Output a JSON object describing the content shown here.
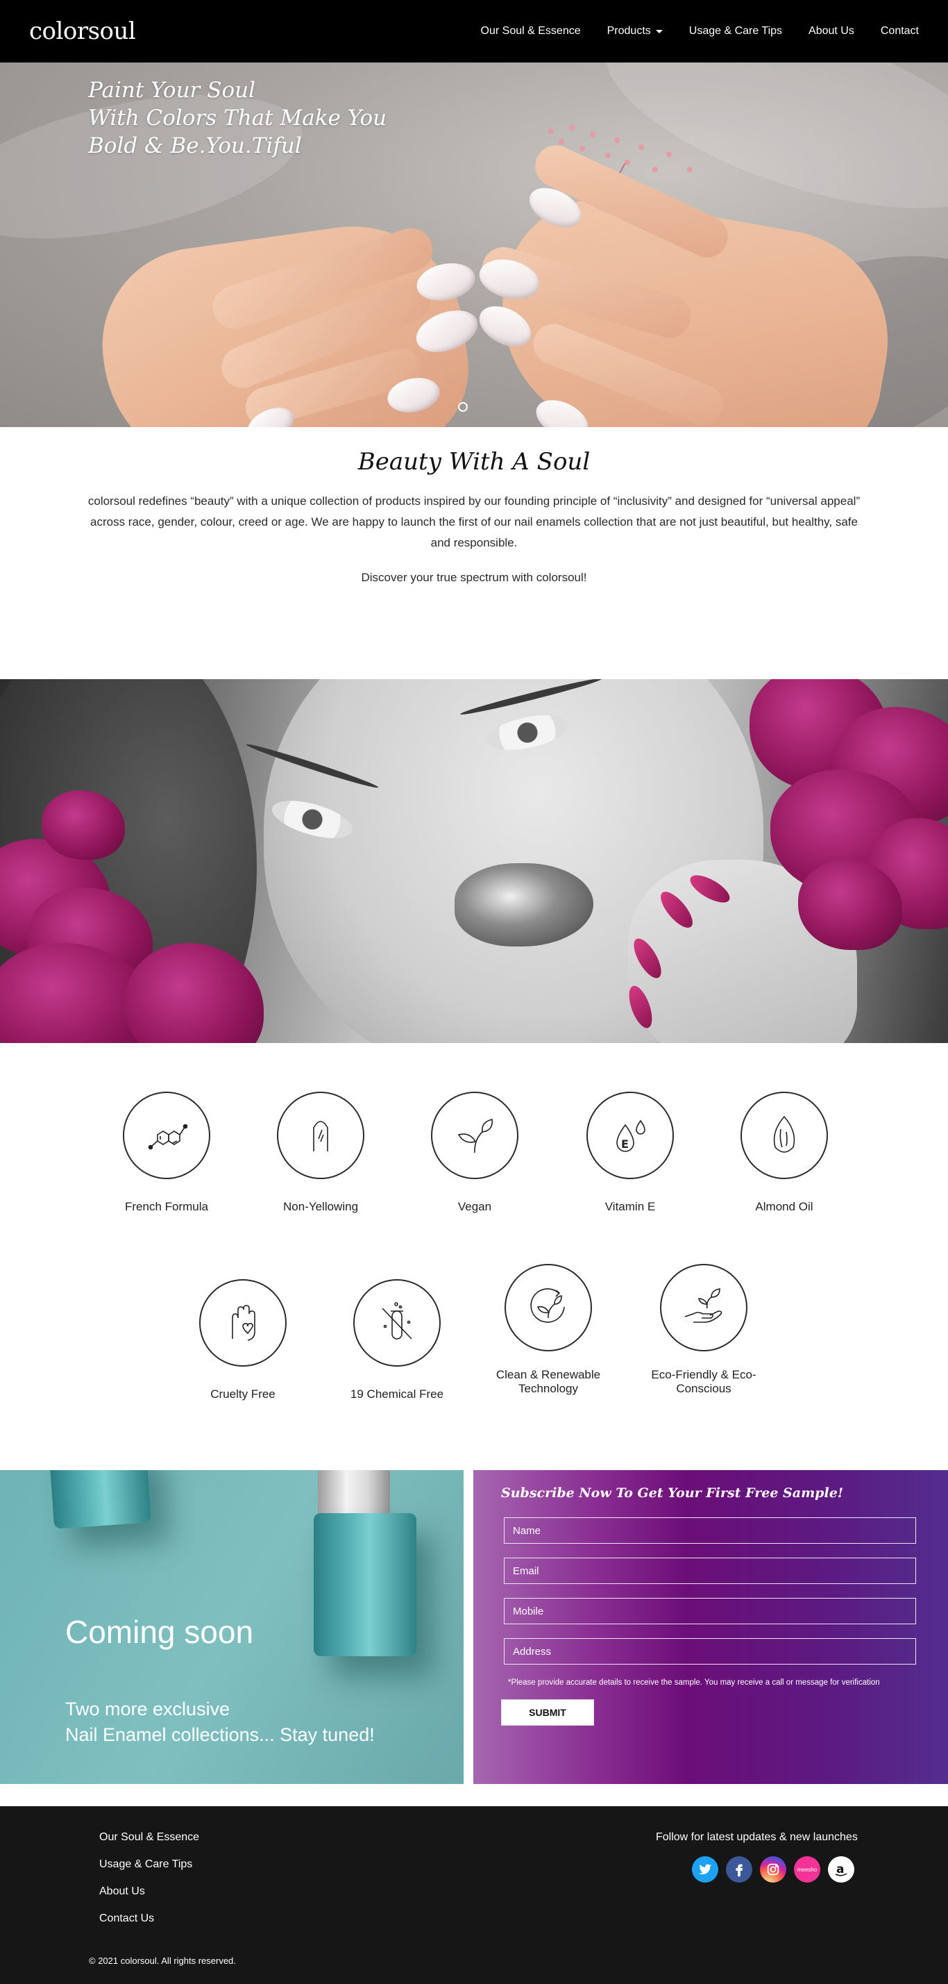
{
  "nav": {
    "logo": "colorsoul",
    "links": [
      "Our Soul & Essence",
      "Products",
      "Usage & Care Tips",
      "About Us",
      "Contact"
    ]
  },
  "hero": {
    "tagline": [
      "Paint Your Soul",
      "With Colors That Make You",
      "Bold & Be.You.Tiful"
    ]
  },
  "intro": {
    "title": "Beauty With A Soul",
    "body": "colorsoul redefines “beauty” with a unique collection of products inspired by our founding principle of “inclusivity” and designed for “universal appeal” across race, gender, colour, creed or age. We are happy to launch the first of our nail enamels collection that are not just beautiful, but healthy, safe and responsible.",
    "discover": "Discover your true spectrum with colorsoul!"
  },
  "features": [
    {
      "label": "French Formula",
      "icon": "molecule-icon"
    },
    {
      "label": "Non-Yellowing",
      "icon": "nail-icon"
    },
    {
      "label": "Vegan",
      "icon": "leaf-icon"
    },
    {
      "label": "Vitamin E",
      "icon": "vitamin-e-drop-icon"
    },
    {
      "label": "Almond Oil",
      "icon": "almond-icon"
    },
    {
      "label": "Cruelty Free",
      "icon": "hand-heart-icon"
    },
    {
      "label": "19 Chemical Free",
      "icon": "test-tube-crossed-icon"
    },
    {
      "label": "Clean & Renewable Technology",
      "icon": "renewable-leaf-icon"
    },
    {
      "label": "Eco-Friendly & Eco-Conscious",
      "icon": "hand-leaf-icon"
    }
  ],
  "coming_soon": {
    "title": "Coming soon",
    "line1": "Two more exclusive",
    "line2": "Nail Enamel collections... Stay tuned!"
  },
  "subscribe": {
    "heading": "Subscribe Now To Get Your First Free Sample!",
    "name_placeholder": "Name",
    "email_placeholder": "Email",
    "mobile_placeholder": "Mobile",
    "address_placeholder": "Address",
    "note": "*Please provide accurate details to receive the sample. You may receive a call or message for verification",
    "submit": "SUBMIT"
  },
  "footer": {
    "links": [
      "Our Soul & Essence",
      "Usage & Care Tips",
      "About Us",
      "Contact Us"
    ],
    "follow": "Follow for latest updates & new launches",
    "social": [
      {
        "name": "twitter-icon",
        "color": "#1da1f2"
      },
      {
        "name": "facebook-icon",
        "color": "#3b5998"
      },
      {
        "name": "instagram-icon",
        "color": "#d6249f"
      },
      {
        "name": "meesho-icon",
        "color": "#f43397",
        "text": "meesho"
      },
      {
        "name": "amazon-icon",
        "color": "#ffffff"
      }
    ],
    "copyright": "© 2021 colorsoul. All rights reserved."
  }
}
